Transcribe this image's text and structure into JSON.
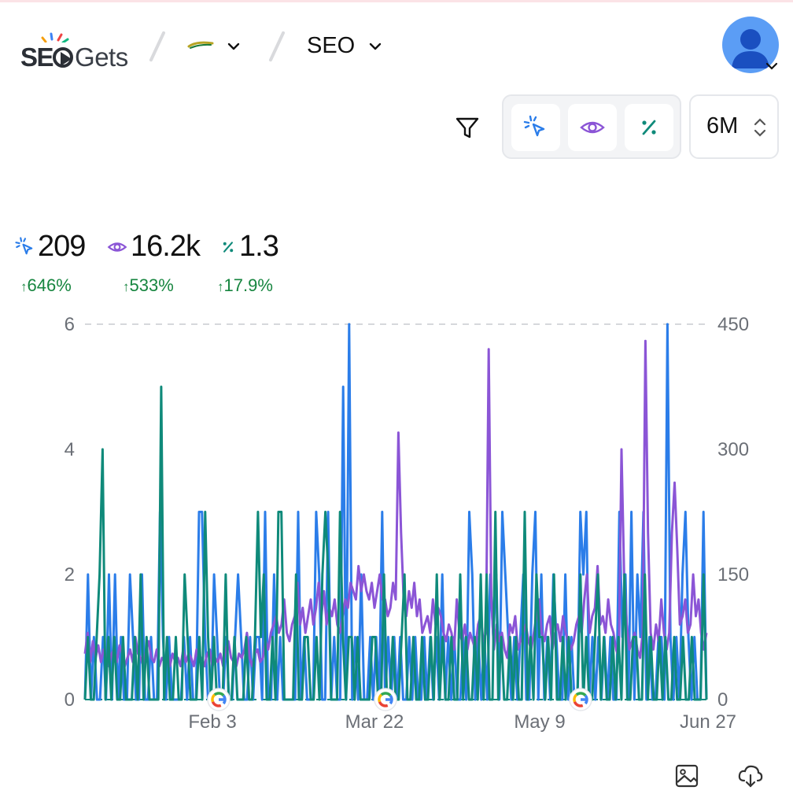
{
  "header": {
    "logo": "SEO Gets",
    "logo_parts": {
      "a": "SE",
      "b": "Gets"
    },
    "site_icon": "site-favicon-swoosh",
    "project_label": "SEO",
    "avatar_icon": "user-avatar-icon"
  },
  "toolbar": {
    "filter_icon": "filter-icon",
    "metrics": [
      {
        "name": "clicks",
        "icon": "cursor-click-icon",
        "color": "#2b7de9"
      },
      {
        "name": "impressions",
        "icon": "eye-icon",
        "color": "#8b55d6"
      },
      {
        "name": "ctr",
        "icon": "percent-icon",
        "color": "#0f8a7a"
      }
    ],
    "range_label": "6M"
  },
  "stats": {
    "clicks": {
      "value": "209",
      "delta": "646%"
    },
    "impressions": {
      "value": "16.2k",
      "delta": "533%"
    },
    "ctr": {
      "value": "1.3",
      "delta": "17.9%"
    },
    "delta_arrow": "↑",
    "delta_color": "#16853f"
  },
  "chart_data": {
    "type": "line",
    "x_ticks": [
      "Feb 3",
      "Mar 22",
      "May 9",
      "Jun 27"
    ],
    "y_left_ticks": [
      "0",
      "2",
      "4",
      "6"
    ],
    "y_right_ticks": [
      "0",
      "150",
      "300",
      "450"
    ],
    "ylim_left": [
      0,
      6
    ],
    "ylim_right": [
      0,
      450
    ],
    "grid": "dashed top line",
    "google_update_markers": [
      "Feb 3",
      "Mar 22",
      "May 16"
    ],
    "series": [
      {
        "color": "#2b7de9",
        "axis": "left",
        "values": [
          0,
          2,
          0,
          1,
          0,
          0,
          1,
          0,
          2,
          0,
          2,
          0,
          1,
          0,
          0,
          2,
          1,
          0,
          0,
          2,
          0,
          0,
          1,
          0,
          0,
          3,
          1,
          0,
          1,
          0,
          0,
          0,
          0,
          1,
          0,
          1,
          0,
          0,
          3,
          3,
          1,
          0,
          0,
          2,
          1,
          0,
          0,
          1,
          0,
          0,
          1,
          2,
          1,
          0,
          0,
          1,
          0,
          1,
          1,
          0,
          3,
          0,
          0,
          2,
          0,
          1,
          0,
          0,
          0,
          0,
          0,
          3,
          0,
          1,
          0,
          0,
          0,
          3,
          2,
          0,
          0,
          3,
          0,
          1,
          0,
          0,
          5,
          0,
          6,
          0,
          1,
          0,
          2,
          0,
          0,
          1,
          0,
          1,
          0,
          3,
          0,
          1,
          0,
          1,
          0,
          1,
          0,
          0,
          1,
          0,
          1,
          0,
          0,
          1,
          0,
          1,
          0,
          1,
          0,
          2,
          0,
          1,
          0,
          1,
          0,
          0,
          1,
          0,
          3,
          2,
          0,
          1,
          0,
          1,
          0,
          2,
          1,
          2,
          0,
          3,
          2,
          1,
          0,
          1,
          0,
          1,
          2,
          0,
          0,
          2,
          3,
          0,
          2,
          0,
          1,
          0,
          2,
          1,
          0,
          0,
          2,
          0,
          1,
          0,
          0,
          3,
          2,
          3,
          0,
          1,
          0,
          1,
          0,
          1,
          0,
          1,
          0,
          0,
          3,
          1,
          2,
          0,
          3,
          0,
          2,
          1,
          3,
          0,
          1,
          0,
          0,
          1,
          1,
          0,
          6,
          1,
          0,
          1,
          0,
          2,
          3,
          1,
          0,
          1,
          0,
          0,
          3,
          0
        ]
      },
      {
        "color": "#8b55d6",
        "axis": "right",
        "values": [
          55,
          80,
          45,
          70,
          50,
          65,
          45,
          60,
          50,
          40,
          55,
          60,
          45,
          65,
          55,
          40,
          50,
          60,
          45,
          75,
          55,
          50,
          40,
          60,
          70,
          50,
          45,
          60,
          40,
          50,
          45,
          60,
          40,
          55,
          45,
          50,
          40,
          60,
          45,
          55,
          50,
          40,
          60,
          45,
          50,
          40,
          55,
          60,
          40,
          50,
          45,
          55,
          40,
          60,
          70,
          50,
          45,
          40,
          55,
          50,
          60,
          80,
          50,
          40,
          55,
          60,
          45,
          50,
          70,
          60,
          80,
          90,
          100,
          80,
          90,
          120,
          80,
          70,
          90,
          100,
          140,
          90,
          110,
          80,
          100,
          120,
          90,
          110,
          140,
          100,
          130,
          90,
          110,
          100,
          120,
          90,
          80,
          100,
          120,
          110,
          140,
          130,
          120,
          160,
          130,
          150,
          130,
          120,
          140,
          110,
          130,
          150,
          120,
          120,
          100,
          110,
          140,
          120,
          320,
          200,
          120,
          100,
          130,
          110,
          140,
          100,
          120,
          80,
          90,
          100,
          80,
          120,
          90,
          110,
          100,
          80,
          70,
          90,
          80,
          60,
          120,
          80,
          70,
          90,
          60,
          80,
          70,
          60,
          90,
          100,
          70,
          80,
          420,
          120,
          60,
          90,
          70,
          80,
          60,
          50,
          90,
          80,
          100,
          60,
          70,
          80,
          90,
          70,
          60,
          80,
          100,
          120,
          80,
          70,
          90,
          100,
          60,
          80,
          90,
          70,
          100,
          80,
          70,
          60,
          70,
          90,
          100,
          80,
          120,
          150,
          80,
          100,
          110,
          160,
          90,
          100,
          80,
          120,
          90,
          80,
          60,
          50,
          300,
          150,
          90,
          60,
          70,
          80,
          60,
          50,
          80,
          430,
          200,
          80,
          60,
          90,
          70,
          120,
          80,
          60,
          80,
          200,
          260,
          180,
          90,
          100,
          120,
          80,
          90,
          150,
          100,
          120,
          80,
          60,
          80
        ]
      },
      {
        "color": "#0f8a7a",
        "axis": "left",
        "values": [
          0,
          1,
          0,
          0,
          1,
          2,
          4,
          0,
          1,
          0,
          1,
          0,
          0,
          1,
          0,
          0,
          0,
          1,
          0,
          2,
          0,
          1,
          0,
          0,
          0,
          0,
          5,
          0,
          1,
          0,
          0,
          1,
          0,
          0,
          2,
          1,
          0,
          0,
          0,
          1,
          0,
          3,
          1,
          0,
          1,
          0,
          0,
          0,
          2,
          0,
          0,
          1,
          0,
          0,
          0,
          1,
          0,
          0,
          1,
          3,
          1,
          2,
          0,
          0,
          1,
          0,
          3,
          3,
          0,
          0,
          0,
          0,
          2,
          0,
          0,
          1,
          1,
          0,
          0,
          1,
          0,
          2,
          3,
          2,
          0,
          0,
          0,
          3,
          1,
          0,
          1,
          1,
          0,
          1,
          0,
          0,
          0,
          0,
          1,
          1,
          0,
          0,
          2,
          0,
          0,
          1,
          0,
          0,
          1,
          2,
          0,
          0,
          1,
          0,
          0,
          1,
          0,
          0,
          1,
          0,
          2,
          0,
          1,
          0,
          0,
          1,
          0,
          0,
          2,
          0,
          1,
          0,
          0,
          1,
          0,
          2,
          0,
          2,
          0,
          0,
          3,
          0,
          1,
          0,
          0,
          1,
          0,
          1,
          0,
          0,
          3,
          0,
          1,
          0,
          2,
          1,
          1,
          0,
          1,
          0,
          2,
          0,
          0,
          1,
          0,
          1,
          0,
          0,
          0,
          2,
          0,
          1,
          0,
          0,
          1,
          2,
          0,
          1,
          0,
          0,
          1,
          0,
          1,
          0,
          2,
          0,
          0,
          1,
          1,
          0,
          0,
          2,
          0,
          1,
          0,
          0,
          1,
          0,
          1,
          0,
          0,
          1,
          0,
          0,
          1,
          0,
          0,
          1,
          0,
          0,
          0,
          2,
          0
        ]
      }
    ]
  },
  "footer": {
    "image_icon": "image-export-icon",
    "download_icon": "cloud-download-icon"
  }
}
